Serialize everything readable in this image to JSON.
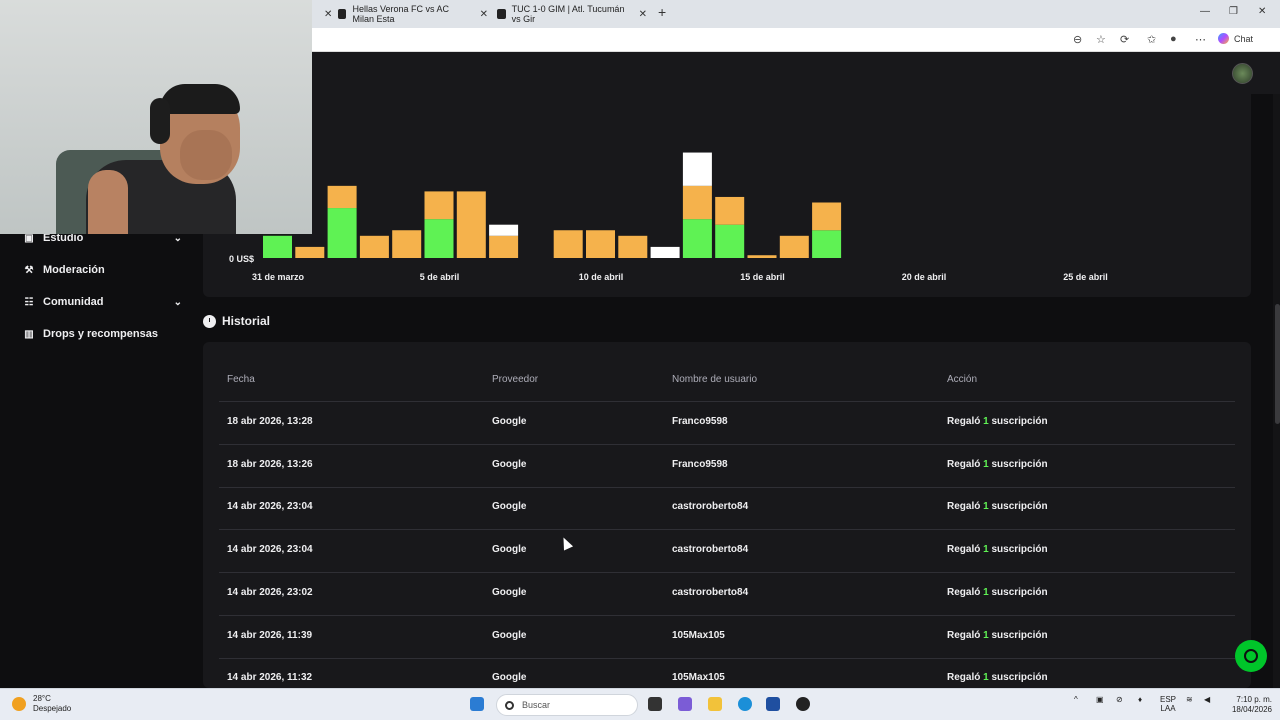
{
  "browser": {
    "tabs": [
      {
        "label": "Hellas Verona FC vs AC Milan Esta"
      },
      {
        "label": "TUC 1-0 GIM | Atl. Tucumán vs Gir"
      }
    ],
    "new_tab_symbol": "+",
    "chat_label": "Chat"
  },
  "sidebar": {
    "items": [
      {
        "label": "Estudio",
        "icon": "camera-icon",
        "has_chevron": true
      },
      {
        "label": "Moderación",
        "icon": "wrench-icon",
        "has_chevron": false
      },
      {
        "label": "Comunidad",
        "icon": "users-icon",
        "has_chevron": true
      },
      {
        "label": "Drops y recompensas",
        "icon": "chart-icon",
        "has_chevron": false
      }
    ]
  },
  "chart_data": {
    "type": "bar",
    "stacked": true,
    "ylabel_tick": "0 US$",
    "x_tick_labels": [
      "31 de marzo",
      "5 de abril",
      "10 de abril",
      "15 de abril",
      "20 de abril",
      "25 de abril"
    ],
    "categories": [
      "31 mar",
      "1 abr",
      "2 abr",
      "3 abr",
      "4 abr",
      "5 abr",
      "6 abr",
      "7 abr",
      "8 abr",
      "9 abr",
      "10 abr",
      "11 abr",
      "12 abr",
      "13 abr",
      "14 abr",
      "15 abr",
      "16 abr",
      "17 abr",
      "18 abr",
      "19 abr",
      "20 abr",
      "21 abr",
      "22 abr",
      "23 abr",
      "24 abr",
      "25 abr",
      "26 abr",
      "27 abr",
      "28 abr",
      "29 abr"
    ],
    "series": [
      {
        "color": "#5ff254",
        "values": [
          4,
          0,
          9,
          0,
          0,
          7,
          0,
          0,
          0,
          0,
          0,
          0,
          0,
          7,
          6,
          0,
          0,
          5,
          0,
          0,
          0,
          0,
          0,
          0,
          0,
          0,
          0,
          0,
          0,
          0
        ]
      },
      {
        "color": "#f5b24c",
        "values": [
          0,
          2,
          4,
          4,
          5,
          5,
          12,
          4,
          0,
          5,
          5,
          4,
          0,
          6,
          5,
          0.5,
          4,
          5,
          0,
          0,
          0,
          0,
          0,
          0,
          0,
          0,
          0,
          0,
          0,
          0
        ]
      },
      {
        "color": "#ffffff",
        "values": [
          0,
          0,
          0,
          0,
          0,
          0,
          0,
          2,
          0,
          0,
          0,
          0,
          2,
          6,
          0,
          0,
          0,
          0,
          0,
          0,
          0,
          0,
          0,
          0,
          0,
          0,
          0,
          0,
          0,
          0
        ]
      }
    ]
  },
  "history": {
    "title": "Historial",
    "columns": [
      "Fecha",
      "Proveedor",
      "Nombre de usuario",
      "Acción"
    ],
    "rows": [
      {
        "date": "18 abr 2026, 13:28",
        "provider": "Google",
        "user": "Franco9598",
        "action_pre": "Regaló",
        "action_num": "1",
        "action_post": "suscripción"
      },
      {
        "date": "18 abr 2026, 13:26",
        "provider": "Google",
        "user": "Franco9598",
        "action_pre": "Regaló",
        "action_num": "1",
        "action_post": "suscripción"
      },
      {
        "date": "14 abr 2026, 23:04",
        "provider": "Google",
        "user": "castroroberto84",
        "action_pre": "Regaló",
        "action_num": "1",
        "action_post": "suscripción"
      },
      {
        "date": "14 abr 2026, 23:04",
        "provider": "Google",
        "user": "castroroberto84",
        "action_pre": "Regaló",
        "action_num": "1",
        "action_post": "suscripción"
      },
      {
        "date": "14 abr 2026, 23:02",
        "provider": "Google",
        "user": "castroroberto84",
        "action_pre": "Regaló",
        "action_num": "1",
        "action_post": "suscripción"
      },
      {
        "date": "14 abr 2026, 11:39",
        "provider": "Google",
        "user": "105Max105",
        "action_pre": "Regaló",
        "action_num": "1",
        "action_post": "suscripción"
      },
      {
        "date": "14 abr 2026, 11:32",
        "provider": "Google",
        "user": "105Max105",
        "action_pre": "Regaló",
        "action_num": "1",
        "action_post": "suscripción"
      }
    ]
  },
  "taskbar": {
    "weather_temp": "28°C",
    "weather_desc": "Despejado",
    "search_placeholder": "Buscar",
    "lang_top": "ESP",
    "lang_bottom": "LAA",
    "time": "7:10 p. m.",
    "date": "18/04/2026"
  },
  "colors": {
    "accent_green": "#5ff254",
    "accent_orange": "#f5b24c",
    "support_green": "#00c52a",
    "card_bg": "#18181b"
  }
}
